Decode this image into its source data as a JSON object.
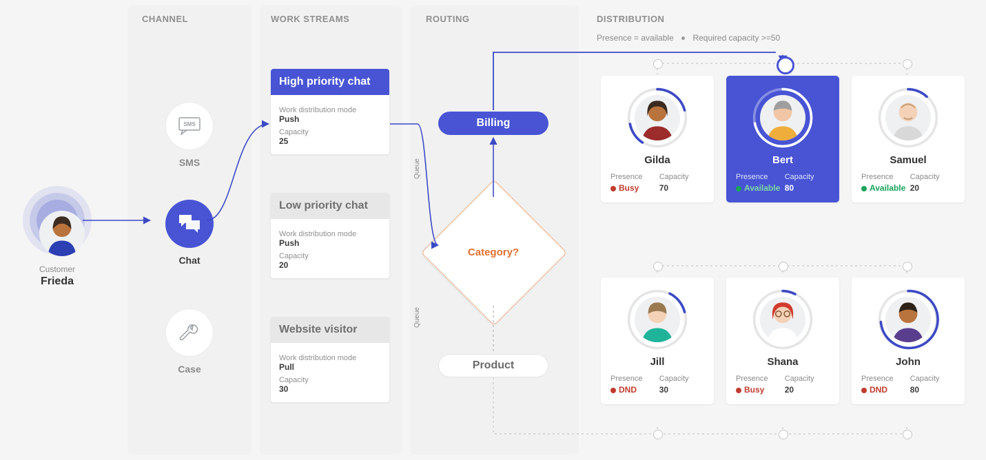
{
  "sections": {
    "channel": "CHANNEL",
    "work_streams": "WORK STREAMS",
    "routing": "ROUTING",
    "distribution": "DISTRIBUTION"
  },
  "distribution_rule": {
    "presence": "Presence = available",
    "capacity": "Required capacity >=50"
  },
  "customer": {
    "label": "Customer",
    "name": "Frieda"
  },
  "channels": {
    "sms": {
      "label": "SMS",
      "active": false
    },
    "chat": {
      "label": "Chat",
      "active": true
    },
    "case": {
      "label": "Case",
      "active": false
    }
  },
  "work_streams": [
    {
      "title": "High priority chat",
      "mode_label": "Work distribution mode",
      "mode": "Push",
      "capacity_label": "Capacity",
      "capacity": "25",
      "primary": true
    },
    {
      "title": "Low priority chat",
      "mode_label": "Work distribution mode",
      "mode": "Push",
      "capacity_label": "Capacity",
      "capacity": "20",
      "primary": false
    },
    {
      "title": "Website visitor",
      "mode_label": "Work distribution mode",
      "mode": "Pull",
      "capacity_label": "Capacity",
      "capacity": "30",
      "primary": false
    }
  ],
  "routing": {
    "queue_label": "Queue",
    "decision": "Category?",
    "queue_billing": "Billing",
    "queue_product": "Product"
  },
  "meta_labels": {
    "presence": "Presence",
    "capacity": "Capacity"
  },
  "agents_top": [
    {
      "name": "Gilda",
      "presence": "Busy",
      "presence_style": "red",
      "capacity": "70",
      "selected": false
    },
    {
      "name": "Bert",
      "presence": "Available",
      "presence_style": "green",
      "capacity": "80",
      "selected": true
    },
    {
      "name": "Samuel",
      "presence": "Available",
      "presence_style": "green",
      "capacity": "20",
      "selected": false
    }
  ],
  "agents_bottom": [
    {
      "name": "Jill",
      "presence": "DND",
      "presence_style": "red",
      "capacity": "30"
    },
    {
      "name": "Shana",
      "presence": "Busy",
      "presence_style": "red",
      "capacity": "20"
    },
    {
      "name": "John",
      "presence": "DND",
      "presence_style": "red",
      "capacity": "80"
    }
  ]
}
